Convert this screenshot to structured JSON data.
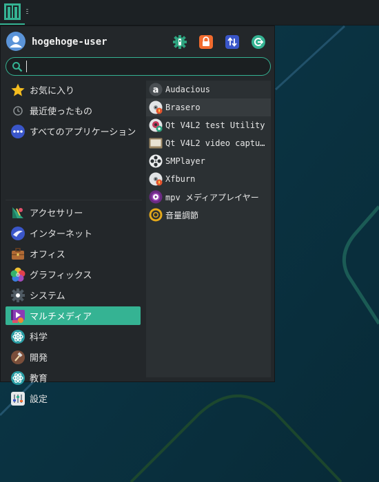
{
  "user": {
    "name": "hogehoge-user"
  },
  "actions": [
    {
      "name": "settings",
      "icon": "settings-gear-icon",
      "color": "#2ea37f"
    },
    {
      "name": "lock",
      "icon": "lock-icon",
      "color": "#f26b2e"
    },
    {
      "name": "switch-user",
      "icon": "switch-user-icon",
      "color": "#3a56c9"
    },
    {
      "name": "logout",
      "icon": "logout-icon",
      "color": "#35b393"
    }
  ],
  "search": {
    "value": "",
    "placeholder": ""
  },
  "categories": [
    {
      "label": "お気に入り",
      "icon": "star-icon"
    },
    {
      "label": "最近使ったもの",
      "icon": "clock-icon"
    },
    {
      "label": "すべてのアプリケーション",
      "icon": "apps-dots-icon"
    },
    {
      "label": "アクセサリー",
      "icon": "accessories-icon"
    },
    {
      "label": "インターネット",
      "icon": "globe-icon"
    },
    {
      "label": "オフィス",
      "icon": "briefcase-icon"
    },
    {
      "label": "グラフィックス",
      "icon": "graphics-flower-icon"
    },
    {
      "label": "システム",
      "icon": "system-gear-icon"
    },
    {
      "label": "マルチメディア",
      "icon": "multimedia-icon",
      "selected": true
    },
    {
      "label": "科学",
      "icon": "science-atom-icon"
    },
    {
      "label": "開発",
      "icon": "development-hammer-icon"
    },
    {
      "label": "教育",
      "icon": "education-atom-icon"
    },
    {
      "label": "設定",
      "icon": "settings-panel-icon"
    }
  ],
  "apps": [
    {
      "label": "Audacious",
      "icon": "audacious-icon"
    },
    {
      "label": "Brasero",
      "icon": "brasero-disc-icon",
      "hover": true
    },
    {
      "label": "Qt V4L2 test Utility",
      "icon": "qv4l2-icon"
    },
    {
      "label": "Qt V4L2 video captu…",
      "icon": "qvidcap-icon"
    },
    {
      "label": "SMPlayer",
      "icon": "smplayer-reel-icon"
    },
    {
      "label": "Xfburn",
      "icon": "xfburn-disc-icon"
    },
    {
      "label": "mpv メディアプレイヤー",
      "icon": "mpv-icon"
    },
    {
      "label": "音量調節",
      "icon": "volume-control-icon"
    }
  ],
  "colors": {
    "accent": "#35b393",
    "desktop": "#0b3343",
    "menu_bg": "#23272a",
    "apps_bg": "#2b3033"
  }
}
